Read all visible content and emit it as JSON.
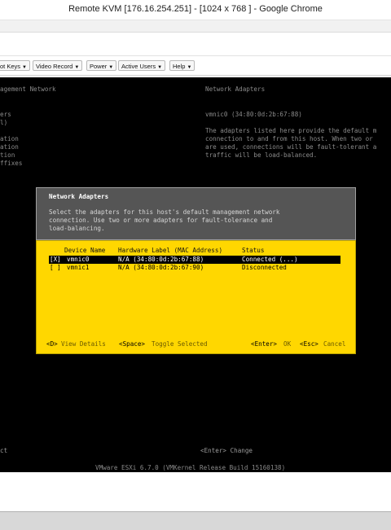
{
  "window": {
    "title": "Remote KVM [176.16.254.251] - [1024 x 768 ] - Google Chrome"
  },
  "toolbar": {
    "buttons": [
      {
        "label": "ot Keys"
      },
      {
        "label": "Video Record"
      },
      {
        "label": "Power"
      },
      {
        "label": "Active Users"
      },
      {
        "label": "Help"
      }
    ]
  },
  "console": {
    "left_header": "agement Network",
    "left_items": [
      "ers",
      "l)",
      "ation",
      "ation",
      "tion",
      "ffixes"
    ],
    "right_header": "Network Adapters",
    "right_nic": "vmnic0 (34:80:0d:2b:67:88)",
    "right_desc": [
      "The adapters listed here provide the default m",
      "connection to and from this host. When two or",
      "are used, connections will be fault-tolerant a",
      "traffic will be load-balanced."
    ],
    "bottom_left": "ct",
    "bottom_right": "<Enter> Change",
    "build_line": "VMware ESXi 6.7.0 (VMKernel Release Build 15160138)"
  },
  "dialog": {
    "title": "Network Adapters",
    "description": [
      "Select the adapters for this host's default management network",
      "connection. Use two or more adapters for fault-tolerance and",
      "load-balancing."
    ],
    "columns": {
      "device": "Device Name",
      "hw": "Hardware Label (MAC Address)",
      "status": "Status"
    },
    "rows": [
      {
        "check": "[X]",
        "device": "vmnic0",
        "hw": "N/A (34:80:0d:2b:67:88)",
        "status": "Connected (...)"
      },
      {
        "check": "[ ]",
        "device": "vmnic1",
        "hw": "N/A (34:80:0d:2b:67:90)",
        "status": "Disconnected"
      }
    ],
    "footer": {
      "details_key": "<D>",
      "details_label": "View Details",
      "toggle_key": "<Space>",
      "toggle_label": "Toggle Selected",
      "ok_key": "<Enter>",
      "ok_label": "OK",
      "cancel_key": "<Esc>",
      "cancel_label": "Cancel"
    }
  }
}
